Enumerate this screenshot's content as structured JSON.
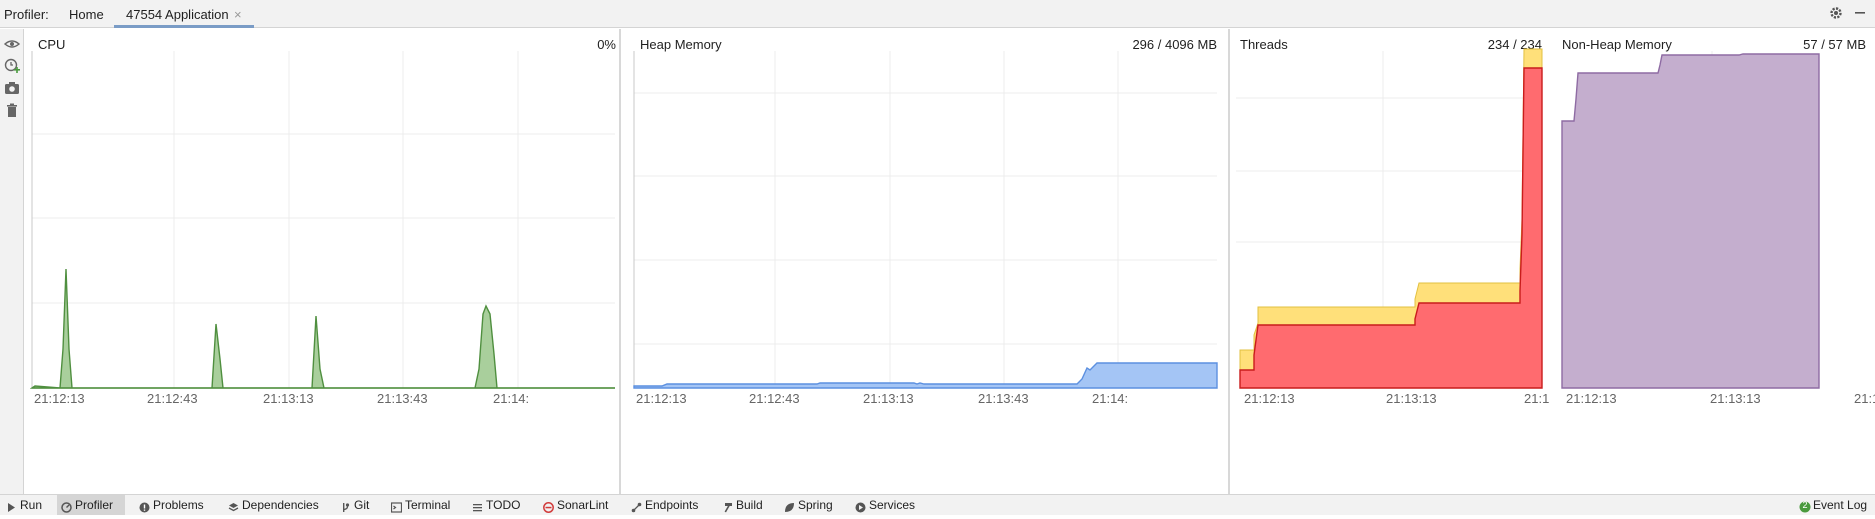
{
  "header": {
    "profiler_label": "Profiler:",
    "tabs": [
      {
        "label": "Home"
      },
      {
        "label": "47554 Application",
        "close": "×"
      }
    ]
  },
  "panels": {
    "cpu": {
      "title": "CPU",
      "value": "0%",
      "ticks": [
        "21:12:13",
        "21:12:43",
        "21:13:13",
        "21:13:43",
        "21:14:"
      ]
    },
    "heap": {
      "title": "Heap Memory",
      "value": "296 / 4096 MB",
      "ticks": [
        "21:12:13",
        "21:12:43",
        "21:13:13",
        "21:13:43",
        "21:14:"
      ]
    },
    "threads": {
      "title": "Threads",
      "value": "234 / 234",
      "ticks": [
        "21:12:13",
        "21:13:13",
        "21:1"
      ]
    },
    "nonheap": {
      "title": "Non-Heap Memory",
      "value": "57 / 57 MB",
      "ticks": [
        "21:12:13",
        "21:13:13",
        "21:1"
      ]
    }
  },
  "colors": {
    "cpu": "#5d9b4e",
    "heap": "#89b2ee",
    "threads_total": "#ffe07a",
    "threads_live": "#ff6b6f",
    "nonheap": "#c4aece"
  },
  "bottom": {
    "items": [
      {
        "label": "Run",
        "icon": "play-icon"
      },
      {
        "label": "Profiler",
        "icon": "profiler-icon"
      },
      {
        "label": "Problems",
        "icon": "problems-icon"
      },
      {
        "label": "Dependencies",
        "icon": "dependencies-icon"
      },
      {
        "label": "Git",
        "icon": "git-icon"
      },
      {
        "label": "Terminal",
        "icon": "terminal-icon"
      },
      {
        "label": "TODO",
        "icon": "todo-icon"
      },
      {
        "label": "SonarLint",
        "icon": "sonarlint-icon"
      },
      {
        "label": "Endpoints",
        "icon": "endpoints-icon"
      },
      {
        "label": "Build",
        "icon": "hammer-icon"
      },
      {
        "label": "Spring",
        "icon": "spring-icon"
      },
      {
        "label": "Services",
        "icon": "services-icon"
      }
    ],
    "event_log": {
      "label": "Event Log",
      "count": "2"
    }
  }
}
